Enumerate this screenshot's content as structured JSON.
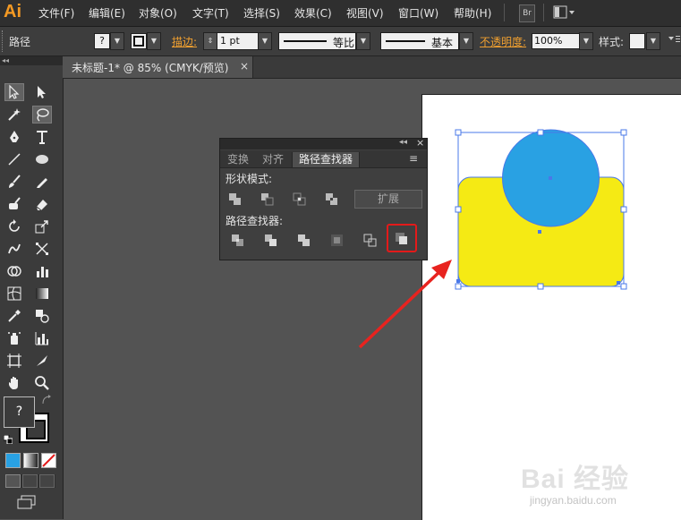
{
  "app": {
    "logo": "Ai"
  },
  "menu": [
    "文件(F)",
    "编辑(E)",
    "对象(O)",
    "文字(T)",
    "选择(S)",
    "效果(C)",
    "视图(V)",
    "窗口(W)",
    "帮助(H)"
  ],
  "menubar_icons": {
    "bridge": "Br"
  },
  "control_bar": {
    "selection_label": "路径",
    "fill_value": "?",
    "stroke_label": "描边:",
    "stroke_weight": "1 pt",
    "profile_label": "等比",
    "brush_label": "基本",
    "opacity_label": "不透明度:",
    "opacity_value": "100%",
    "style_label": "样式:"
  },
  "document_tab": {
    "title": "未标题-1* @ 85% (CMYK/预览)",
    "close": "×"
  },
  "tools": {
    "collapse": "◂◂",
    "fill_unknown": "?"
  },
  "pathfinder_panel": {
    "collapse": "◂◂",
    "close": "×",
    "tabs": [
      "变换",
      "对齐",
      "路径查找器"
    ],
    "active_tab": 2,
    "menu_icon": "≡",
    "shape_modes_label": "形状模式:",
    "expand_button": "扩展",
    "pathfinders_label": "路径查找器:"
  },
  "artwork": {
    "rect_color": "#f5ea14",
    "circle_color": "#29a1e3",
    "selection_color": "#4a78e8",
    "arrow_color": "#e8231f"
  },
  "watermark": {
    "logo": "Bai 经验",
    "url": "jingyan.baidu.com"
  }
}
